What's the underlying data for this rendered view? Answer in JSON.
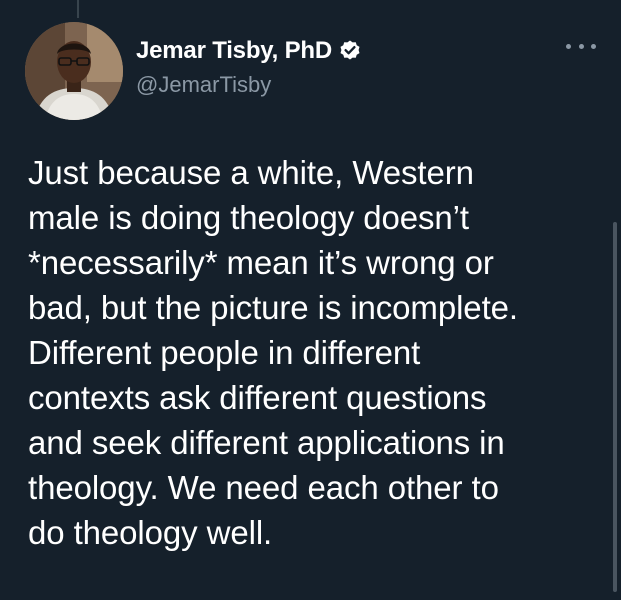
{
  "author": {
    "display_name": "Jemar Tisby, PhD",
    "handle": "@JemarTisby",
    "verified_icon": "verified-badge-icon",
    "avatar": "profile-photo"
  },
  "tweet": {
    "text": "Just because a white, Western\nmale is doing theology doesn’t\n*necessarily* mean it’s wrong or\nbad, but the picture is incomplete.\nDifferent people in different\ncontexts ask different questions\nand seek different applications in\ntheology. We need each other to\ndo theology well."
  },
  "menu": {
    "icon": "more-options-icon"
  },
  "colors": {
    "background": "#15202b",
    "text_primary": "#ffffff",
    "text_secondary": "#8b98a5"
  }
}
